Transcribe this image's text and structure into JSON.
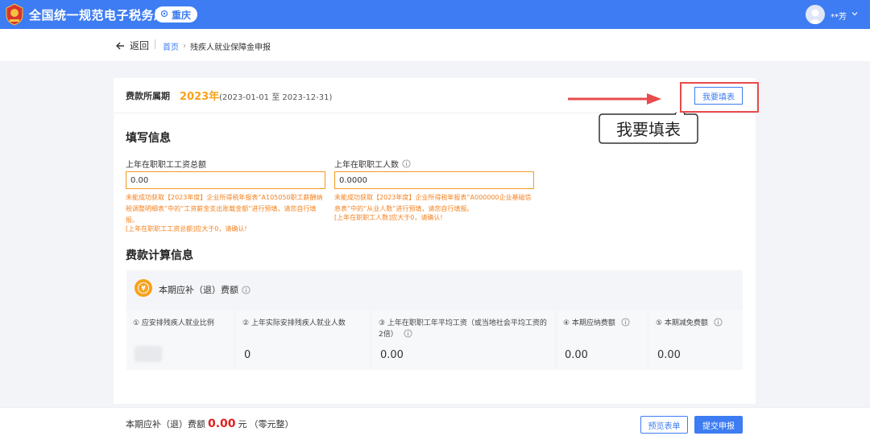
{
  "header": {
    "brand": "全国统一规范电子税务局",
    "region": "重庆",
    "user": "**芳"
  },
  "nav": {
    "back_label": "返回",
    "breadcrumb": {
      "home": "首页",
      "separator": "›",
      "current": "残疾人就业保障金申报"
    }
  },
  "period": {
    "label": "费款所属期",
    "year": "2023年",
    "range": "(2023-01-01 至 2023-12-31)",
    "fill_button": "我要填表"
  },
  "fill_info": {
    "title": "填写信息",
    "salary": {
      "label": "上年在职职工工资总额",
      "value": "0.00",
      "help_1": "未能成功获取【2023年度】企业所得税年报表“A105050职工薪酬纳税调整明细表”中的“工资薪金支出账载金额”进行预填，请您自行填报。",
      "help_2": "[上年在职职工工资总额]应大于0，请确认!"
    },
    "headcount": {
      "label": "上年在职职工人数",
      "value": "0.0000",
      "help_1": "未能成功获取【2023年度】企业所得税年报表“A000000企业基础信息表”中的“从业人数”进行预填，请您自行填报。",
      "help_2": "[上年在职职工人数]应大于0，请确认!"
    }
  },
  "fee_calc": {
    "title": "费款计算信息",
    "head_label": "本期应补（退）费额",
    "yen_symbol": "¥",
    "columns": [
      {
        "label": "① 应安排残疾人就业比例",
        "value": ""
      },
      {
        "label": "② 上年实际安排残疾人就业人数",
        "value": "0"
      },
      {
        "label": "③ 上年在职职工年平均工资（或当地社会平均工资的2倍）",
        "value": "0.00"
      },
      {
        "label": "④ 本期应纳费额",
        "value": "0.00"
      },
      {
        "label": "⑤ 本期减免费额",
        "value": "0.00"
      }
    ]
  },
  "footer": {
    "total_prefix": "本期应补（退）费额",
    "total_amount": "0.00",
    "total_unit": "元",
    "total_words": "（零元整）",
    "preview_button": "预览表单",
    "submit_button": "提交申报"
  },
  "annotation": {
    "callout_text": "我要填表",
    "highlight_color": "#e84b4b"
  },
  "colors": {
    "primary": "#3d7cf2",
    "accent_orange": "#f7a21b",
    "warning_text": "#f5821f",
    "amount_red": "#e02020"
  }
}
